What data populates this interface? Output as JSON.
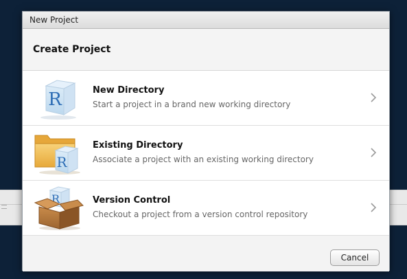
{
  "window": {
    "title": "New Project"
  },
  "header": {
    "title": "Create Project"
  },
  "options": [
    {
      "title": "New Directory",
      "description": "Start a project in a brand new working directory",
      "icon": "r-cube-icon"
    },
    {
      "title": "Existing Directory",
      "description": "Associate a project with an existing working directory",
      "icon": "folder-r-cube-icon"
    },
    {
      "title": "Version Control",
      "description": "Checkout a project from a version control repository",
      "icon": "box-r-cube-icon"
    }
  ],
  "footer": {
    "cancel_label": "Cancel"
  },
  "colors": {
    "background": "#0d2138",
    "dialog": "#f3f3f3",
    "r_letter": "#2d6db5"
  }
}
